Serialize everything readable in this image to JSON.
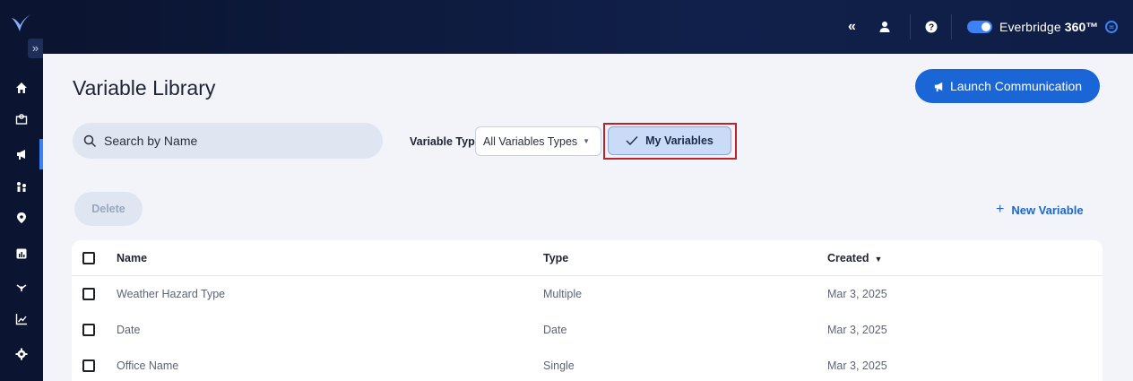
{
  "app": {
    "brand_name": "Everbridge",
    "brand_suffix": "360™"
  },
  "page": {
    "title": "Variable Library"
  },
  "actions": {
    "launch_label": "Launch Communication",
    "delete_label": "Delete",
    "new_variable_label": "New Variable"
  },
  "search": {
    "placeholder": "Search by Name"
  },
  "filters": {
    "variable_type_label": "Variable Type",
    "variable_type_value": "All Variables Types",
    "my_variables_label": "My Variables"
  },
  "table": {
    "columns": {
      "name": "Name",
      "type": "Type",
      "created": "Created"
    },
    "rows": [
      {
        "name": "Weather Hazard Type",
        "type": "Multiple",
        "created": "Mar 3, 2025"
      },
      {
        "name": "Date",
        "type": "Date",
        "created": "Mar 3, 2025"
      },
      {
        "name": "Office Name",
        "type": "Single",
        "created": "Mar 3, 2025"
      }
    ]
  },
  "colors": {
    "accent": "#1b66d6",
    "sidebar": "#0b1430",
    "highlight_border": "#c0202a"
  },
  "icons": {
    "sidebar": [
      "home-icon",
      "dashboard-icon",
      "megaphone-icon",
      "people-icon",
      "location-icon",
      "reports-icon",
      "integrations-icon",
      "analytics-icon",
      "settings-icon"
    ],
    "topbar": [
      "collapse-icon",
      "user-icon",
      "help-icon",
      "toggle-icon",
      "menu-icon"
    ]
  }
}
